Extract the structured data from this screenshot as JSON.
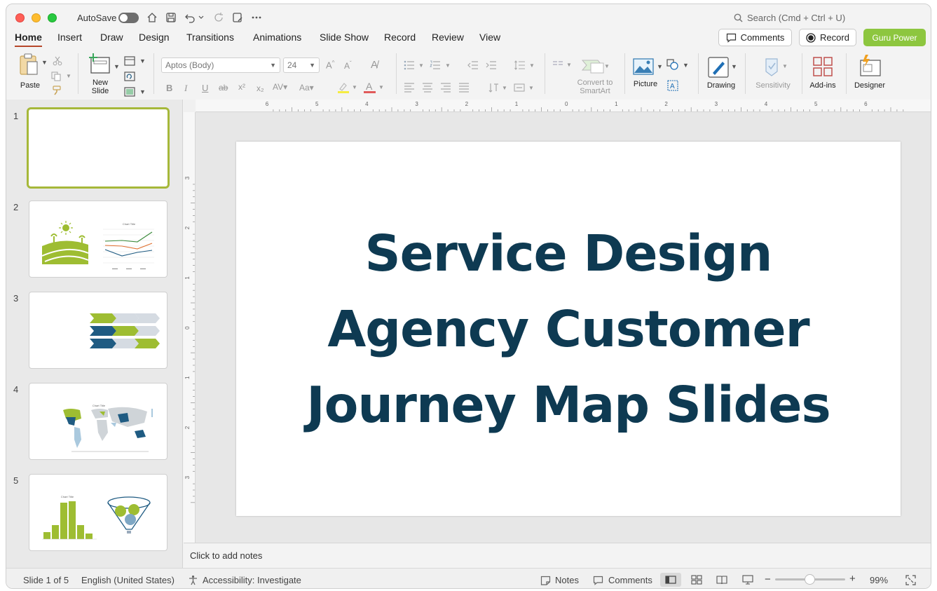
{
  "titlebar": {
    "autosave_label": "AutoSave",
    "search_placeholder": "Search (Cmd + Ctrl + U)"
  },
  "tabs": [
    "Home",
    "Insert",
    "Draw",
    "Design",
    "Transitions",
    "Animations",
    "Slide Show",
    "Record",
    "Review",
    "View"
  ],
  "active_tab": "Home",
  "actions": {
    "comments": "Comments",
    "record": "Record",
    "guru": "Guru Power"
  },
  "ribbon": {
    "paste": "Paste",
    "new_slide": "New Slide",
    "font_name": "Aptos (Body)",
    "font_size": "24",
    "convert_smartart": "Convert to SmartArt",
    "picture": "Picture",
    "drawing": "Drawing",
    "sensitivity": "Sensitivity",
    "addins": "Add-ins",
    "designer": "Designer"
  },
  "slides": [
    {
      "number": "1",
      "selected": true
    },
    {
      "number": "2",
      "selected": false,
      "mini_title": "Chart Title"
    },
    {
      "number": "3",
      "selected": false
    },
    {
      "number": "4",
      "selected": false,
      "mini_title": "Chart Title"
    },
    {
      "number": "5",
      "selected": false,
      "mini_title": "Chart Title"
    }
  ],
  "ruler": {
    "h_labels": [
      "6",
      "5",
      "4",
      "3",
      "2",
      "1",
      "0",
      "1",
      "2",
      "3",
      "4",
      "5",
      "6"
    ],
    "v_labels": [
      "3",
      "2",
      "1",
      "0",
      "1",
      "2",
      "3"
    ]
  },
  "slide": {
    "title_lines": [
      "Service Design",
      "Agency Customer",
      "Journey Map Slides"
    ]
  },
  "notes_placeholder": "Click to add notes",
  "status": {
    "slide_of": "Slide 1 of 5",
    "language": "English (United States)",
    "accessibility": "Accessibility: Investigate",
    "notes": "Notes",
    "comments": "Comments",
    "zoom": "99%"
  },
  "colors": {
    "accent_green": "#8dc63f",
    "title_navy": "#0e3a52",
    "slide_green": "#9ebd32",
    "slide_blue": "#1f5b82",
    "tab_underline": "#b7472a"
  }
}
